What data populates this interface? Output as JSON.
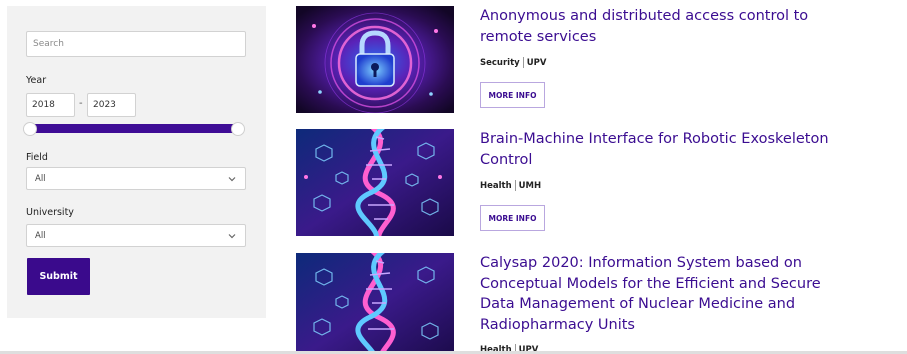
{
  "filters": {
    "search_placeholder": "Search",
    "year_label": "Year",
    "year_from": "2018",
    "year_to": "2023",
    "year_separator": "-",
    "field_label": "Field",
    "field_value": "All",
    "university_label": "University",
    "university_value": "All",
    "submit_label": "Submit"
  },
  "results": [
    {
      "title": "Anonymous and distributed access control to remote services",
      "field": "Security",
      "university": "UPV",
      "button": "MORE INFO",
      "image": "padlock-image"
    },
    {
      "title": "Brain-Machine Interface for Robotic Exoskeleton Control",
      "field": "Health",
      "university": "UMH",
      "button": "MORE INFO",
      "image": "dna-image"
    },
    {
      "title": "Calysap 2020: Information System based on Conceptual Models for the Efficient and Secure Data Management of Nuclear Medicine and Radiopharmacy Units",
      "field": "Health",
      "university": "UPV",
      "image": "dna-image"
    }
  ],
  "colors": {
    "accent": "#3b0d91",
    "slider": "#3f0d96",
    "sidebar_bg": "#f2f2f2"
  }
}
